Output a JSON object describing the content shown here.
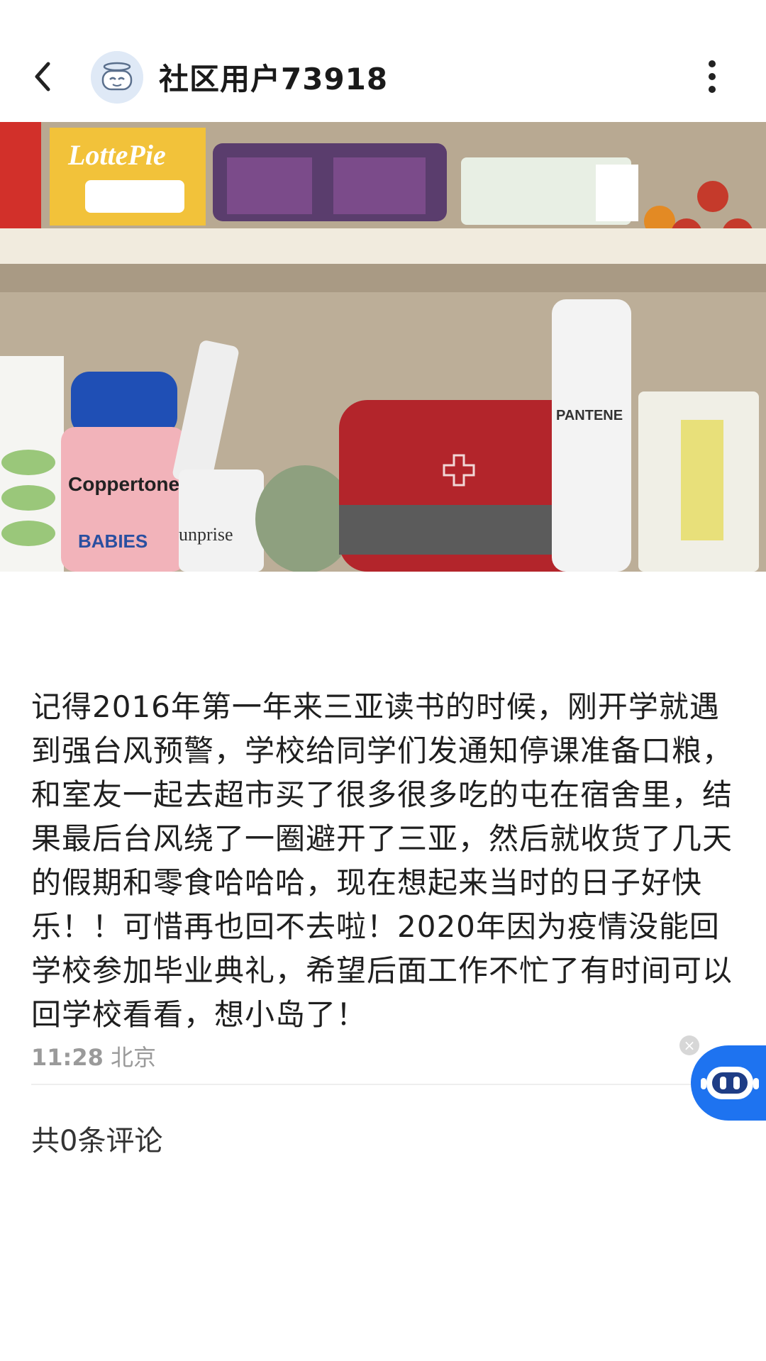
{
  "header": {
    "back_icon": "chevron-left-icon",
    "avatar_icon": "robot-avatar-icon",
    "username": "社区用户73918",
    "more_icon": "more-vertical-icon"
  },
  "post": {
    "photo_description_icon": "shelf-photo",
    "photo_labels": {
      "brand_lotte": "LottePie",
      "brand_coppertone": "Coppertone",
      "coppertone_sub": "BABIES",
      "brand_pantene": "PANTENE",
      "brand_sunprise": "unprise"
    },
    "text": "记得2016年第一年来三亚读书的时候，刚开学就遇到强台风预警，学校给同学们发通知停课准备口粮，和室友一起去超市买了很多很多吃的屯在宿舍里，结果最后台风绕了一圈避开了三亚，然后就收货了几天的假期和零食哈哈哈，现在想起来当时的日子好快乐！！可惜再也回不去啦！2020年因为疫情没能回学校参加毕业典礼，希望后面工作不忙了有时间可以回学校看看，想小岛了！",
    "time": "11:28",
    "location": "北京"
  },
  "comments": {
    "label": "共0条评论"
  },
  "assistant": {
    "icon": "assistant-robot-icon",
    "close_icon": "close-icon",
    "close_glyph": "×"
  },
  "colors": {
    "accent": "#1e73f0",
    "meta_text": "#9a9a9a"
  }
}
